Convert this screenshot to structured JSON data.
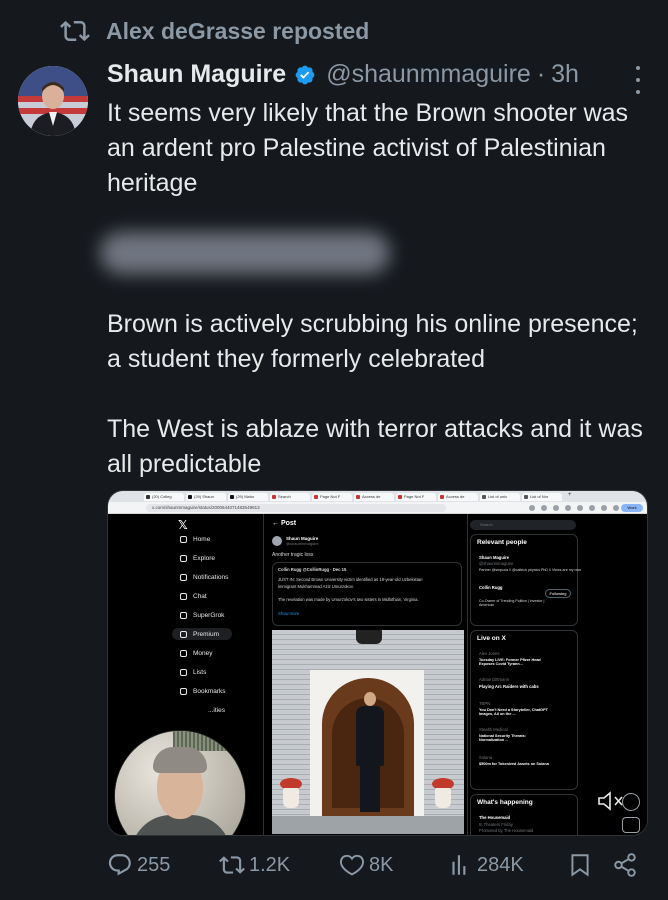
{
  "repost": {
    "label": "Alex deGrasse reposted"
  },
  "tweet": {
    "author_name": "Shaun Maguire",
    "handle": "@shaunmmaguire",
    "separator": "·",
    "time": "3h",
    "paragraph_1": "It seems very likely that the Brown shooter was an ardent pro Palestine activist of Palestinian heritage",
    "paragraph_2": "Brown is actively scrubbing his online presence; a student they formerly celebrated",
    "paragraph_3": "The West is ablaze with terror attacks and it was all predictable"
  },
  "embedded_screenshot": {
    "tabs": [
      "(20) Colleg",
      "(29) Shaun",
      "(29) Maho",
      "Search",
      "Page Not F",
      "Access de",
      "Page Not F",
      "Access de",
      "List of univ",
      "List of Nor"
    ],
    "new_tab": "+",
    "url": "x.com/shaunmmaguire/status/2000644071483549913",
    "work_label": "Work",
    "nav": [
      "Home",
      "Explore",
      "Notifications",
      "Chat",
      "SuperGrok",
      "Premium",
      "Money",
      "Lists",
      "Bookmarks",
      "...ities"
    ],
    "feed": {
      "title": "Post",
      "author": "Shaun Maguire",
      "handle": "@shaunmmaguire",
      "text": "Another tragic loss",
      "quote_author": "Collin Rugg @CollinRugg · Dec 15",
      "quote_line_1": "JUST IN: Second Brown University victim identified as 19-year-old Uzbekistan",
      "quote_line_2": "immigrant Mukhammad Aziz Umurzokov.",
      "quote_line_3": "The revelation was made by Umurzokov's two sisters in Midlothian, Virginia.",
      "show_more": "Show more"
    },
    "sidebar": {
      "search_placeholder": "Search",
      "relevant_title": "Relevant people",
      "person_1": "Shaun Maguire",
      "person_1_handle": "@shaunmmaguire",
      "person_1_bio": "Partner @sequoia // @caltech physics PhD // Views are my own",
      "person_2": "Collin Rugg",
      "person_2_bio": "Co-Owner of Trending Politics | Investor | American",
      "follow_label": "Following",
      "live_title": "Live on X",
      "live_1_host": "Alex Jones",
      "live_1_title": "Tuesday LIVE: Former Pfizer Head Exposes Covid Tyrann...",
      "live_2_host": "Adrian Dittmann",
      "live_2_title": "Playing Arc Raiders with cabs",
      "live_3_host": "TBPN",
      "live_3_title": "You Don't Need a Storyteller, ChatGPT Images, All on the ...",
      "live_4_host": "Stealth Medical",
      "live_4_title": "National Security Threats: Normalization ...",
      "live_5_host": "Solana",
      "live_5_title": "$500m for Tokenized Assets on Solana",
      "happening_title": "What's happening",
      "happening_1": "The Housemaid",
      "happening_2": "In Theaters Friday",
      "happening_3": "Promoted by The Housemaid"
    }
  },
  "actions": {
    "replies": "255",
    "reposts": "1.2K",
    "likes": "8K",
    "views": "284K"
  },
  "colors": {
    "background": "#15181d",
    "text": "#e7e9ea",
    "muted": "#8b98a5",
    "verified": "#1d9bf0"
  }
}
